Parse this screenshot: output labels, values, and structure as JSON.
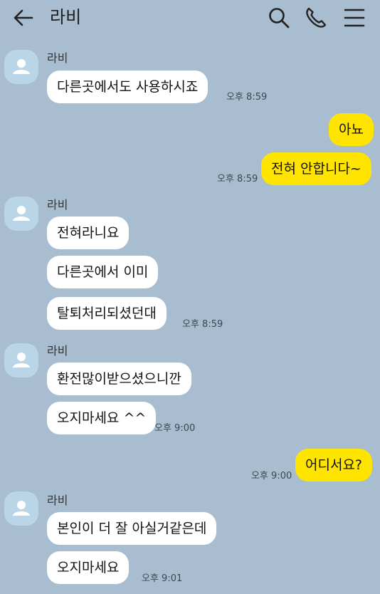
{
  "header": {
    "title": "라비",
    "icons": [
      "back-arrow-icon",
      "search-icon",
      "phone-icon",
      "menu-icon"
    ]
  },
  "colors": {
    "background": "#a9bdd0",
    "incoming_bubble": "#ffffff",
    "outgoing_bubble": "#ffe400",
    "avatar": "#bad4e8"
  },
  "messages": [
    {
      "sender": "라비",
      "text": "다른곳에서도 사용하시죠",
      "time": "오후 8:59"
    },
    {
      "sender": "me",
      "text": "아뇨",
      "time": ""
    },
    {
      "sender": "me",
      "text": "전혀 안합니다~",
      "time": "오후 8:59"
    },
    {
      "sender": "라비",
      "text": "전혀라니요",
      "time": ""
    },
    {
      "sender": "라비",
      "text": "다른곳에서 이미",
      "time": ""
    },
    {
      "sender": "라비",
      "text": "탈퇴처리되셨던대",
      "time": "오후 8:59"
    },
    {
      "sender": "라비",
      "text": "환전많이받으셨으니깐",
      "time": ""
    },
    {
      "sender": "라비",
      "text": "오지마세요 ^^",
      "time": "오후 9:00"
    },
    {
      "sender": "me",
      "text": "어디서요?",
      "time": "오후 9:00"
    },
    {
      "sender": "라비",
      "text": "본인이 더 잘 아실거같은데",
      "time": ""
    },
    {
      "sender": "라비",
      "text": "오지마세요",
      "time": "오후 9:01"
    }
  ]
}
